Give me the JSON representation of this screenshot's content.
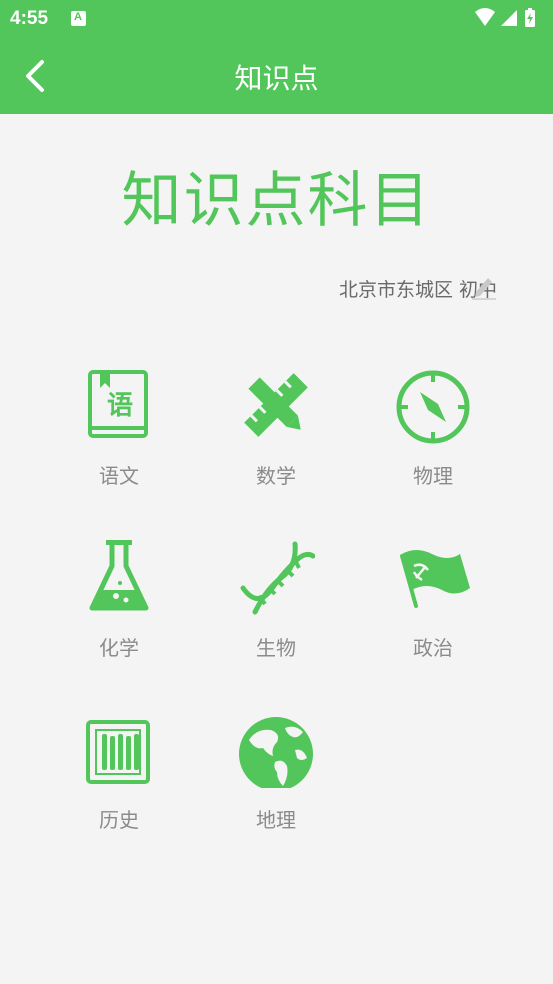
{
  "status_bar": {
    "time": "4:55",
    "notification_icon": "a-icon",
    "system_icons": [
      "wifi-icon",
      "signal-icon",
      "battery-icon"
    ]
  },
  "app_bar": {
    "title": "知识点",
    "back_icon": "chevron-left-icon"
  },
  "header": {
    "big_title": "知识点科目",
    "location": "北京市东城区 初中",
    "edit_icon": "pencil-icon"
  },
  "subjects": [
    {
      "label": "语文",
      "icon": "book-icon"
    },
    {
      "label": "数学",
      "icon": "pencil-ruler-icon"
    },
    {
      "label": "物理",
      "icon": "compass-icon"
    },
    {
      "label": "化学",
      "icon": "flask-icon"
    },
    {
      "label": "生物",
      "icon": "dna-icon"
    },
    {
      "label": "政治",
      "icon": "flag-icon"
    },
    {
      "label": "历史",
      "icon": "scroll-icon"
    },
    {
      "label": "地理",
      "icon": "globe-icon"
    }
  ],
  "colors": {
    "accent": "#52c65a",
    "background": "#f4f4f4",
    "label": "#8b8b8b"
  }
}
